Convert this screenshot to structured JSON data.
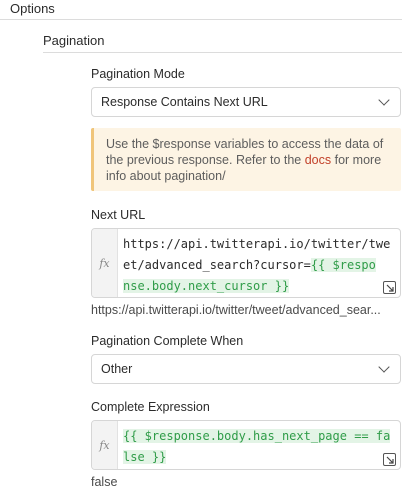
{
  "options": {
    "title": "Options"
  },
  "pagination": {
    "title": "Pagination",
    "mode": {
      "label": "Pagination Mode",
      "value": "Response Contains Next URL"
    },
    "notice": {
      "before": "Use the $response variables to access the data of the previous response. Refer to the ",
      "link": "docs",
      "after": " for more info about pagination/"
    },
    "next_url": {
      "label": "Next URL",
      "fx": "fx",
      "line1": "https://api.twitterapi.io/twitter/twe",
      "line2_plain": "et/advanced_search?cursor=",
      "line2_tpl": "{{ $respo",
      "line3_tpl": "nse.body.next_cursor }}",
      "preview": "https://api.twitterapi.io/twitter/tweet/advanced_sear..."
    },
    "complete_when": {
      "label": "Pagination Complete When",
      "value": "Other"
    },
    "complete_expr": {
      "label": "Complete Expression",
      "fx": "fx",
      "line1_tpl": "{{ $response.body.has_next_page == fa",
      "line2_tpl": "lse }}",
      "preview": "false"
    }
  }
}
